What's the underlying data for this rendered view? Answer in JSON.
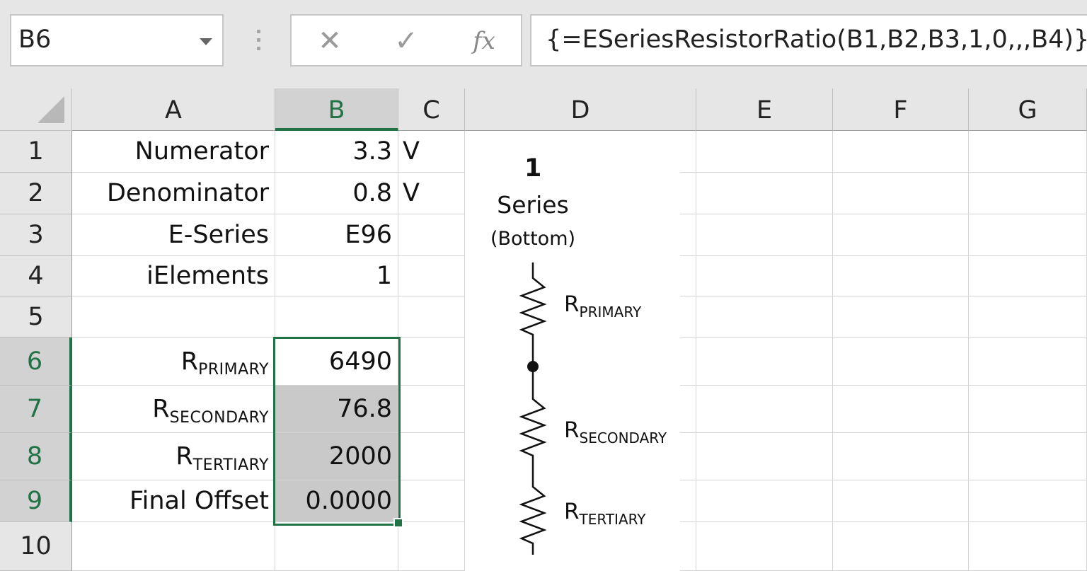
{
  "formula_bar": {
    "name_box": "B6",
    "cancel_icon": "✕",
    "enter_icon": "✓",
    "fx_label": "fx",
    "formula": "{=ESeriesResistorRatio(B1,B2,B3,1,0,,,B4)}"
  },
  "columns": [
    "A",
    "B",
    "C",
    "D",
    "E",
    "F",
    "G"
  ],
  "rows": [
    "1",
    "2",
    "3",
    "4",
    "5",
    "6",
    "7",
    "8",
    "9",
    "10"
  ],
  "cells": {
    "A1": "Numerator",
    "B1": "3.3",
    "C1": "V",
    "A2": "Denominator",
    "B2": "0.8",
    "C2": "V",
    "A3": "E-Series",
    "B3": "E96",
    "A4": "iElements",
    "B4": "1",
    "A6_main": "R",
    "A6_sub": "PRIMARY",
    "B6": "6490",
    "A7_main": "R",
    "A7_sub": "SECONDARY",
    "B7": "76.8",
    "A8_main": "R",
    "A8_sub": "TERTIARY",
    "B8": "2000",
    "A9": "Final Offset",
    "B9": "0.0000"
  },
  "schematic": {
    "number": "1",
    "title": "Series",
    "subtitle": "(Bottom)",
    "labels": [
      {
        "main": "R",
        "sub": "PRIMARY"
      },
      {
        "main": "R",
        "sub": "SECONDARY"
      },
      {
        "main": "R",
        "sub": "TERTIARY"
      }
    ]
  },
  "colors": {
    "selection": "#217346",
    "header_bg": "#e6e6e6",
    "selected_header_bg": "#d2d2d2",
    "shaded_cell": "#c9c9c9"
  }
}
